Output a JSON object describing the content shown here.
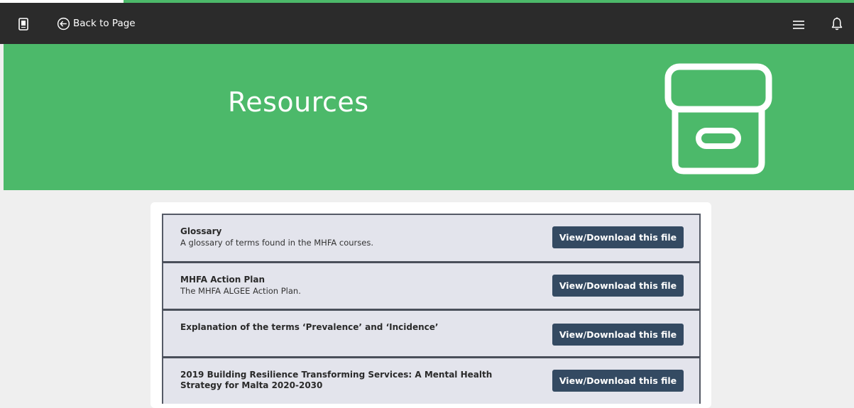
{
  "progress": {
    "percent": 85.5
  },
  "topbar": {
    "back_label": "Back to Page",
    "icons": [
      "book-icon",
      "back-arrow-circle-icon",
      "hamburger-menu-icon",
      "bell-icon"
    ]
  },
  "hero": {
    "title": "Resources",
    "icon": "archive-box-icon"
  },
  "colors": {
    "accent_green": "#4cb96a",
    "topbar": "#2b2b2b",
    "button": "#344a62",
    "row_background": "#e3e4ec"
  },
  "resources": [
    {
      "title": "Glossary",
      "description": "A glossary of terms found in the MHFA courses.",
      "button": "View/Download this file"
    },
    {
      "title": "MHFA Action Plan",
      "description": "The MHFA ALGEE Action Plan.",
      "button": "View/Download this file"
    },
    {
      "title": "Explanation of the terms ‘Prevalence’ and ‘Incidence’",
      "description": "",
      "button": "View/Download this file"
    },
    {
      "title": "2019 Building Resilience Transforming Services: A Mental Health Strategy for Malta 2020-2030",
      "description": "",
      "button": "View/Download this file"
    }
  ]
}
